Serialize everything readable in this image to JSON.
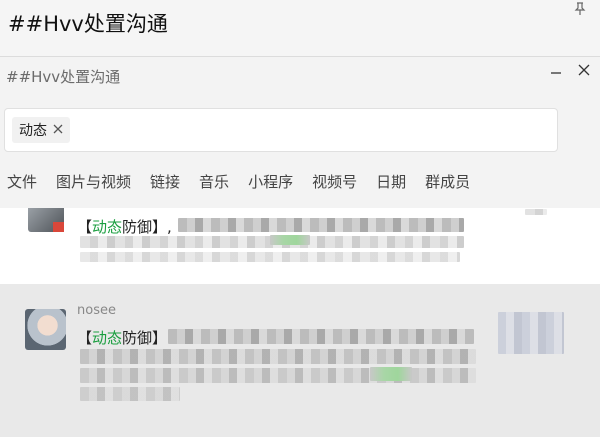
{
  "background_window": {
    "title": "##Hvv处置沟通",
    "pin_icon": "pin-icon"
  },
  "search_panel": {
    "title": "##Hvv处置沟通",
    "minimize_icon": "minimize-icon",
    "close_icon": "close-icon",
    "search": {
      "chip_label": "动态",
      "chip_remove_icon": "close-icon"
    },
    "tabs": [
      {
        "label": "文件"
      },
      {
        "label": "图片与视频"
      },
      {
        "label": "链接"
      },
      {
        "label": "音乐"
      },
      {
        "label": "小程序"
      },
      {
        "label": "视频号"
      },
      {
        "label": "日期"
      },
      {
        "label": "群成员"
      }
    ]
  },
  "results": [
    {
      "bracket_open": "【",
      "highlight": "动态",
      "rest": "防御】",
      "trail": ","
    },
    {
      "sender": "nosee",
      "bracket_open": "【",
      "highlight": "动态",
      "rest": "防御】"
    }
  ],
  "colors": {
    "highlight": "#1a9e3f",
    "selected_row": "#e9e9e9"
  }
}
